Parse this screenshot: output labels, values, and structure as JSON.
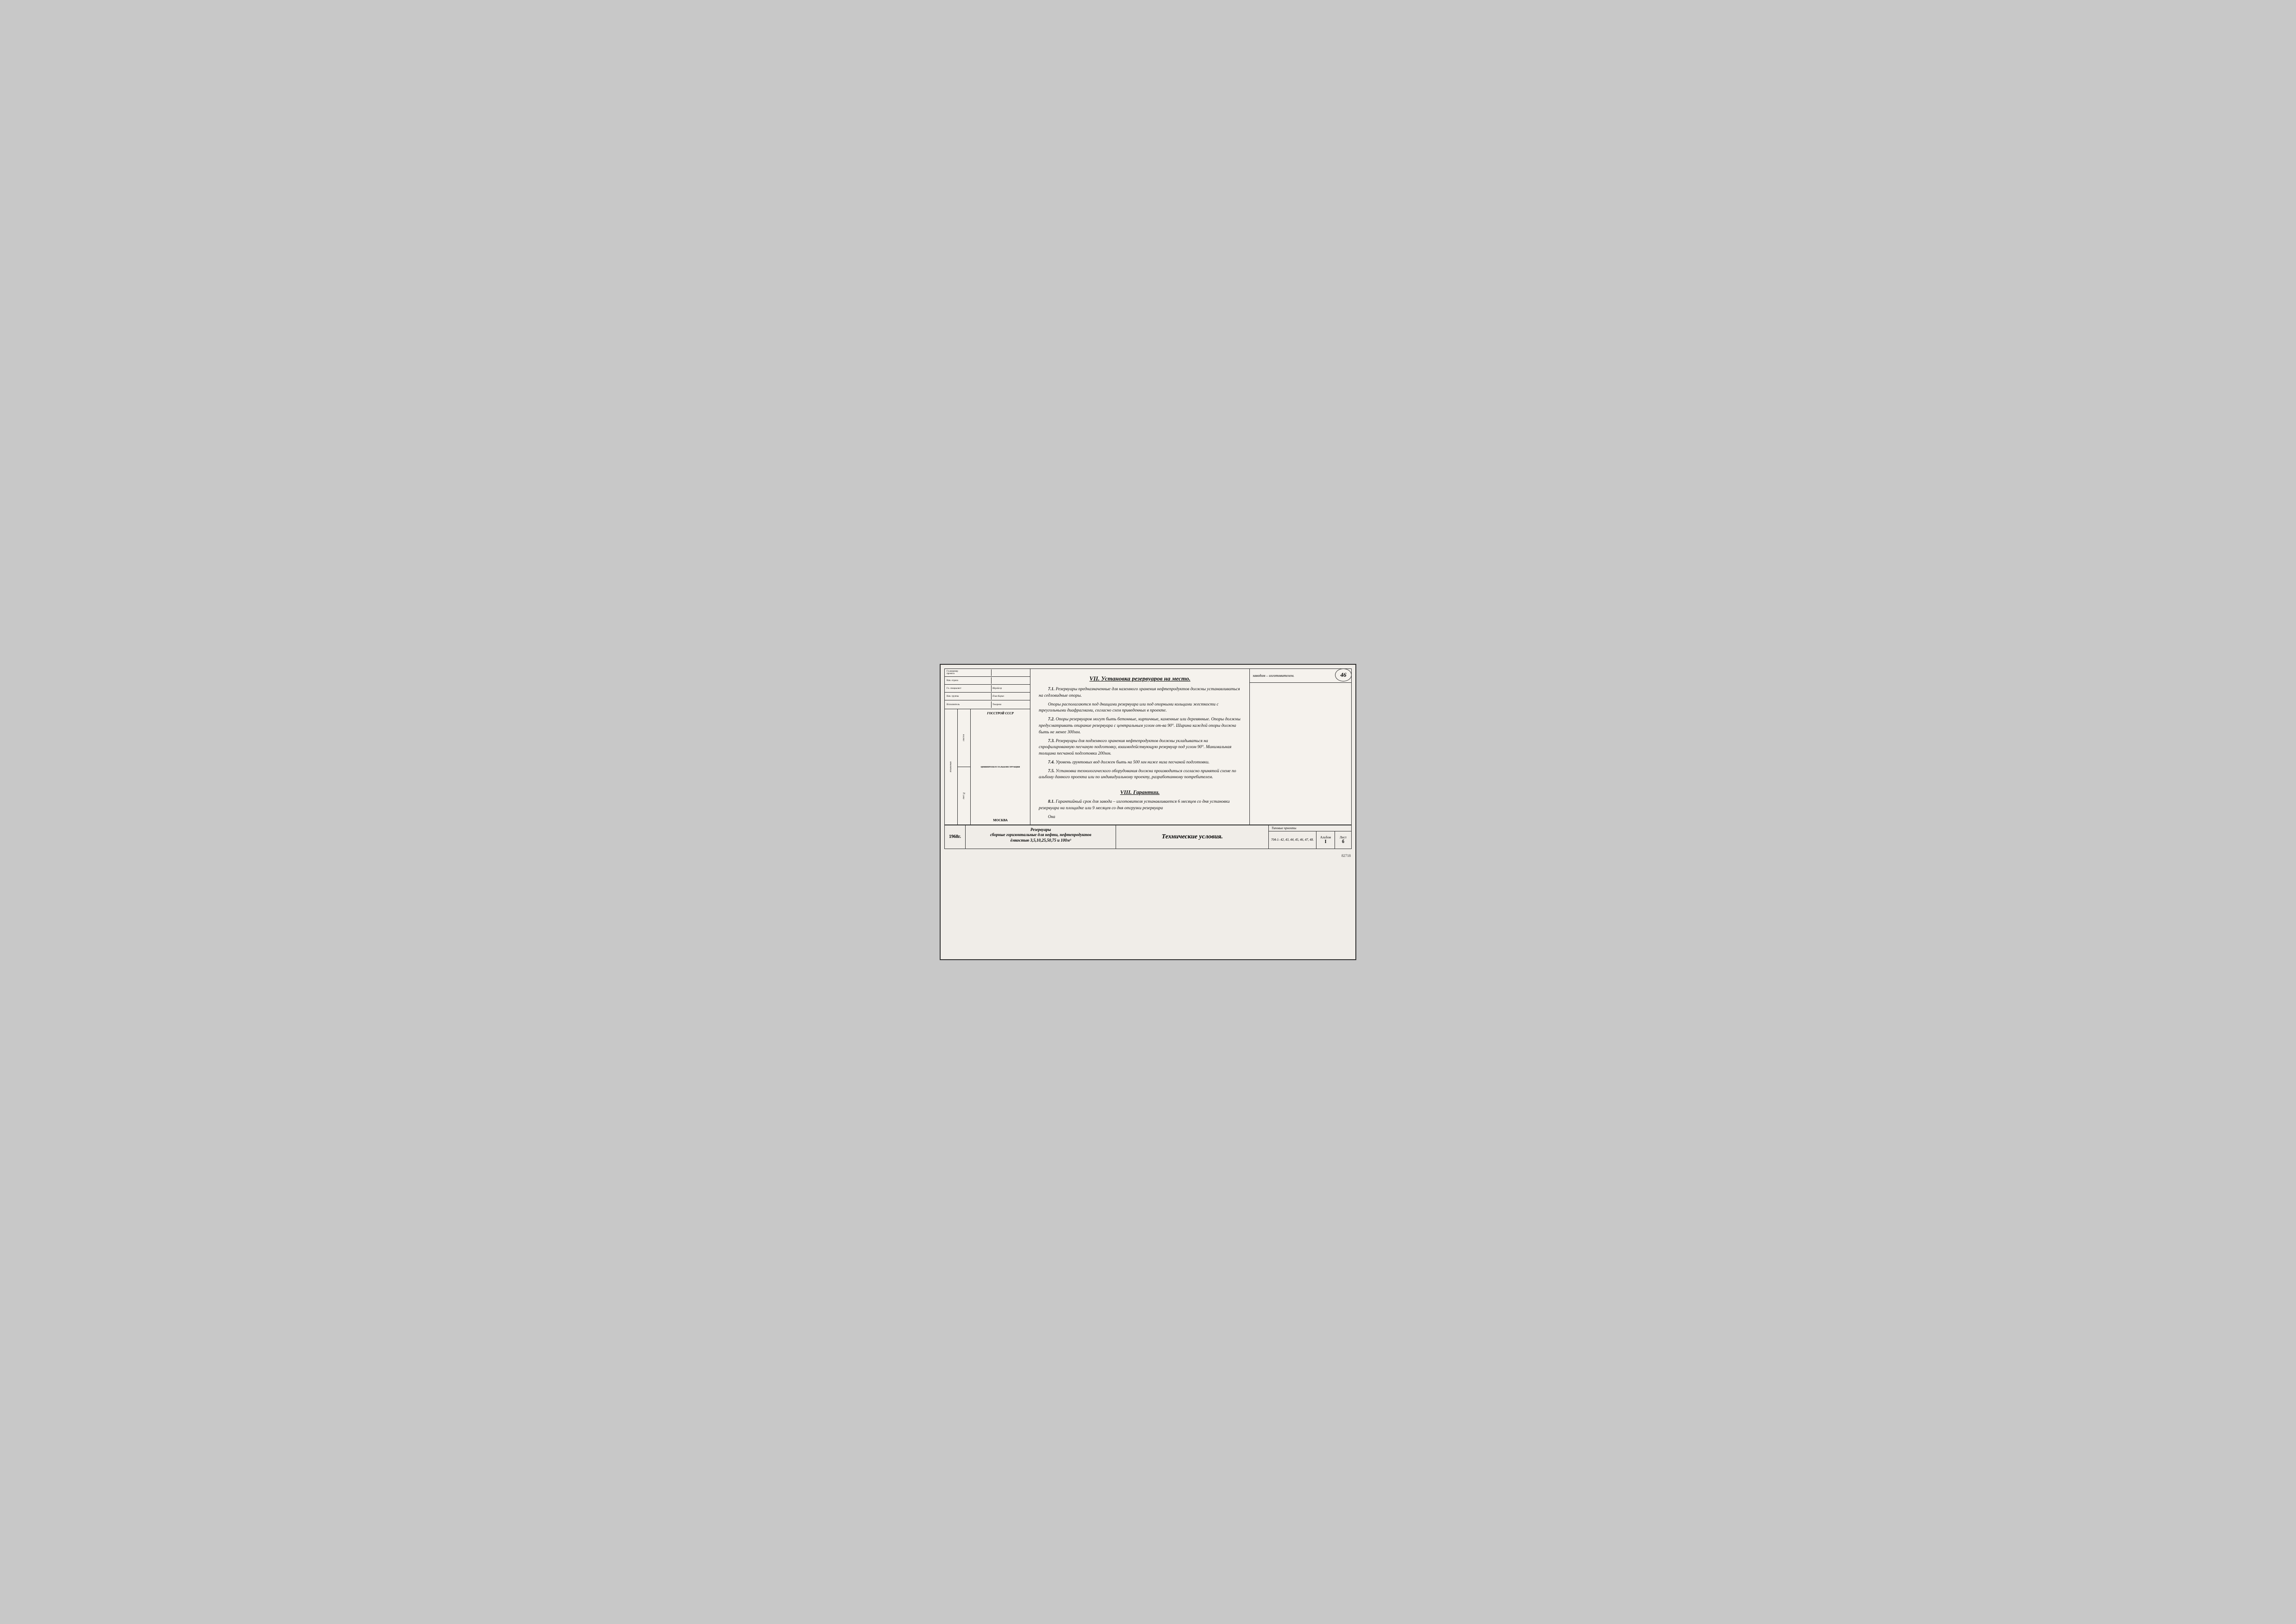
{
  "page": {
    "number": "46",
    "doc_number": "82718",
    "background_color": "#f0ede8"
  },
  "header": {
    "right_text": "заводом – изготовителем."
  },
  "section7": {
    "title": "VII. Установка резервуаров на место.",
    "paragraphs": [
      {
        "num": "7.1.",
        "text": "Резервуары предназначенные для наземного хранения нефтепродуктов должны устанавливаться на седловидные опоры."
      },
      {
        "num": "",
        "text": "Опоры располагаются под днищами резервуара или под опорными кольцами жесткости с треугольными диафрагмами, согласно схем приведенных в проекте."
      },
      {
        "num": "7.2.",
        "text": "Опоры резервуаров могут быть бетонные, кирпичные, каменные или деревянные. Опоры должны предусматривать опирание резервуара с центральным углом от-ва 90°. Ширина каждой опоры должна быть не менее 300мм."
      },
      {
        "num": "7.3.",
        "text": "Резервуары для подземного хранения нефтепродуктов должны укладываться на спрофилированную песчаную подготовку, взаимодействующую резервуар под углом 90°. Минимальная толщина песчаной подготовки 200мм."
      },
      {
        "num": "7.4.",
        "text": "Уровень грунтовых вод должен быть на 500 мм ниже низа песчаной подготовки."
      },
      {
        "num": "7.5.",
        "text": "Установка технологического оборудования должна производиться согласно принятой схеме по альбому данного проекта или по индивидуальному проекту, разработанному потребителем."
      }
    ]
  },
  "section8": {
    "title": "VIII. Гарантии.",
    "paragraphs": [
      {
        "num": "8.1.",
        "text": "Гарантийный срок для завода – изготовителя устанавливается 6 месяцев со дня установки резервуара на площадке или 9 месяцев со дня отгрузки резервуара"
      }
    ]
  },
  "footer": {
    "year": "1968г.",
    "title_line1": "Резервуары",
    "title_line2": "сборные горизонтальные для нефти, нефтепродуктов",
    "title_line3": "ёмкостью 3,5,10,25,50,75 и 100м³",
    "main_label": "Технические условия.",
    "standards": "704-1- 42, 43, 44, 45, 46, 47, 48.",
    "standards_prefix": "Типовые проекты",
    "album_label": "Альбом",
    "album_value": "I",
    "sheet_label": "Лист",
    "sheet_value": "б"
  },
  "sidebar": {
    "ussr": "ГОССТРОЙ СССР",
    "org": "ЦНИИПРОЕКТСТАЛЬКОНСТРУКЦИЯ",
    "city": "МОСКВА",
    "rows": [
      {
        "label": "Гл.инженер проекта",
        "value": ""
      },
      {
        "label": "Нач. отдела",
        "value": ""
      },
      {
        "label": "Гл. специалист",
        "value": ""
      },
      {
        "label": "Нач. группы",
        "value": ""
      },
      {
        "label": "Исполнитель",
        "value": ""
      }
    ]
  },
  "ona": {
    "text": "Она"
  }
}
